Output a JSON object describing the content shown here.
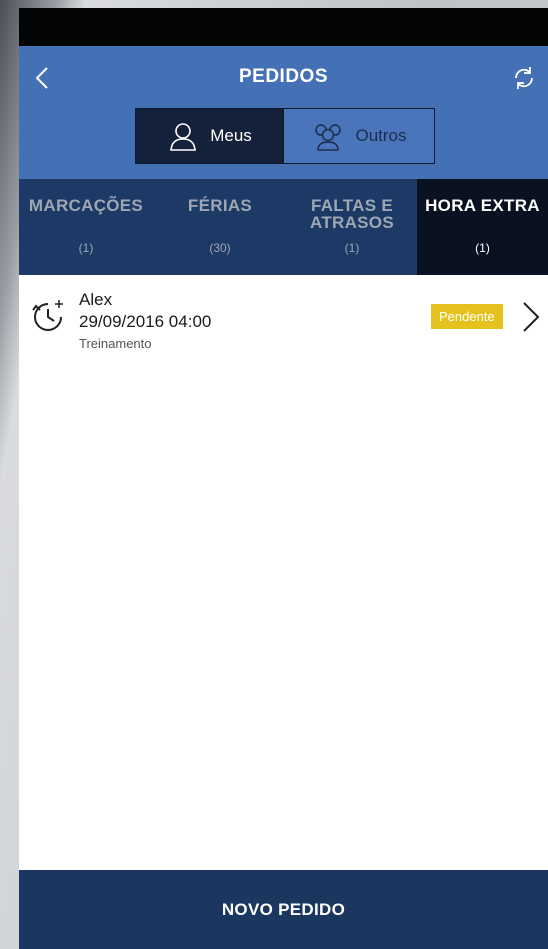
{
  "header": {
    "title": "PEDIDOS"
  },
  "segment": {
    "meus": "Meus",
    "outros": "Outros"
  },
  "tabs": [
    {
      "label": "MARCAÇÕES",
      "count": "(1)"
    },
    {
      "label": "FÉRIAS",
      "count": "(30)"
    },
    {
      "label": "FALTAS E ATRASOS",
      "count": "(1)"
    },
    {
      "label": "HORA EXTRA",
      "count": "(1)"
    }
  ],
  "items": [
    {
      "name": "Alex",
      "datetime": "29/09/2016  04:00",
      "subtitle": "Treinamento",
      "status": "Pendente"
    }
  ],
  "footer": {
    "button": "NOVO PEDIDO"
  },
  "colors": {
    "navbar": "#4470b5",
    "tabs": "#1d3a66",
    "tab_active": "#0a1221",
    "badge": "#e6c21e",
    "footer": "#1b3760"
  },
  "icons": {
    "back": "chevron-left-icon",
    "refresh": "refresh-icon",
    "meus": "user-icon",
    "outros": "group-icon",
    "item": "clock-plus-icon",
    "chevron": "chevron-right-icon"
  }
}
